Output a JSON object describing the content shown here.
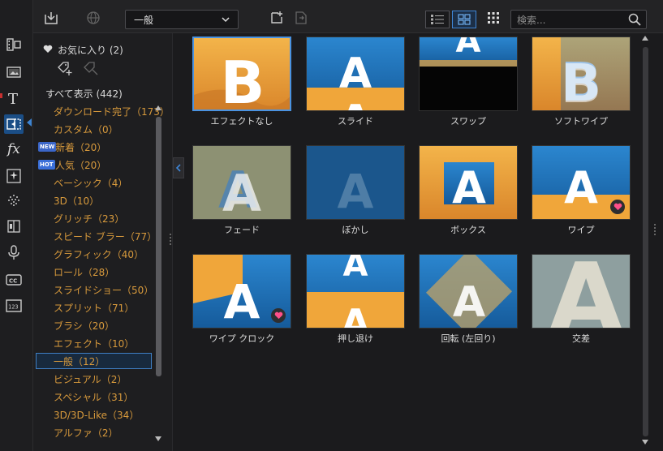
{
  "toolbar": {
    "dropdown_value": "一般",
    "search_placeholder": "検索..."
  },
  "rail": {
    "icons": [
      "media-room-icon",
      "pip-room-icon",
      "title-room-icon",
      "transition-room-icon",
      "effect-room-icon",
      "particle-room-icon",
      "color-room-icon",
      "chapter-room-icon",
      "voice-room-icon",
      "subtitle-room-icon",
      "counter-room-icon"
    ]
  },
  "panel": {
    "favorites": "お気に入り (2)",
    "show_all": "すべて表示 (442)",
    "categories": [
      {
        "label": "ダウンロード完了（173）"
      },
      {
        "label": "カスタム（0）"
      },
      {
        "label": "新着（20）",
        "badge": "NEW"
      },
      {
        "label": "人気（20）",
        "badge": "HOT"
      },
      {
        "label": "ベーシック（4）"
      },
      {
        "label": "3D（10）"
      },
      {
        "label": "グリッチ（23）"
      },
      {
        "label": "スピード ブラー（77）"
      },
      {
        "label": "グラフィック（40）"
      },
      {
        "label": "ロール（28）"
      },
      {
        "label": "スライドショー（50）"
      },
      {
        "label": "スプリット（71）"
      },
      {
        "label": "ブラシ（20）"
      },
      {
        "label": "エフェクト（10）"
      },
      {
        "label": "一般（12）",
        "selected": true
      },
      {
        "label": "ビジュアル（2）"
      },
      {
        "label": "スペシャル（31）"
      },
      {
        "label": "3D/3D-Like（34）"
      },
      {
        "label": "アルファ（2）"
      }
    ]
  },
  "transitions": [
    {
      "label": "エフェクトなし",
      "letter": "B",
      "style": "orange",
      "selected": true
    },
    {
      "label": "スライド",
      "letter": "A",
      "style": "slide"
    },
    {
      "label": "スワップ",
      "letter": "A",
      "style": "swap"
    },
    {
      "label": "ソフトワイプ",
      "letter": "B",
      "style": "softwipe"
    },
    {
      "label": "フェード",
      "letter": "A",
      "style": "fade"
    },
    {
      "label": "ぼかし",
      "letter": "A",
      "style": "blur"
    },
    {
      "label": "ボックス",
      "letter": "A",
      "style": "box"
    },
    {
      "label": "ワイプ",
      "letter": "A",
      "style": "wipe",
      "favorite": true
    },
    {
      "label": "ワイプ クロック",
      "letter": "A",
      "style": "clock",
      "favorite": true
    },
    {
      "label": "押し退け",
      "letter": "A",
      "style": "push"
    },
    {
      "label": "回転 (左回り)",
      "letter": "A",
      "style": "rotate"
    },
    {
      "label": "交差",
      "letter": "A",
      "style": "cross"
    }
  ],
  "colors": {
    "accent": "#3f86d6",
    "category_text": "#d89a3c",
    "orange": "#f0a63a",
    "blue": "#1f6fb8"
  }
}
